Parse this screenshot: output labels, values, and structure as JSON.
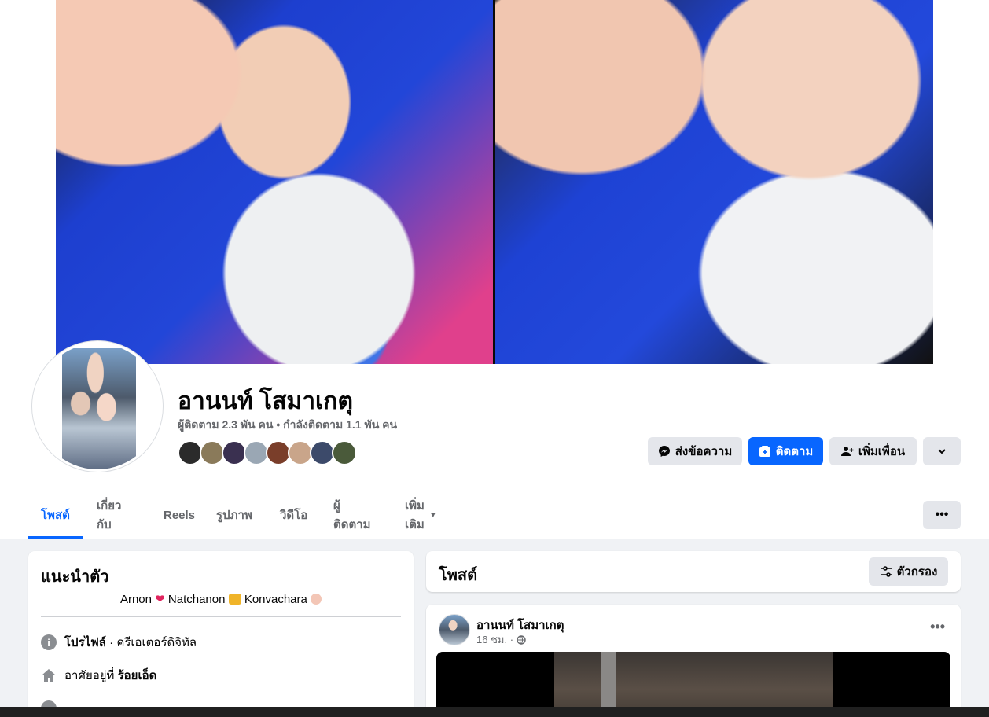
{
  "profile": {
    "name": "อานนท์ โสมาเกตุ",
    "stats": "ผู้ติดตาม 2.3 พัน คน • กำลังติดตาม 1.1 พัน คน"
  },
  "actions": {
    "message": "ส่งข้อความ",
    "follow": "ติดตาม",
    "add_friend": "เพิ่มเพื่อน"
  },
  "tabs": [
    {
      "label": "โพสต์",
      "active": true
    },
    {
      "label": "เกี่ยวกับ",
      "active": false
    },
    {
      "label": "Reels",
      "active": false
    },
    {
      "label": "รูปภาพ",
      "active": false
    },
    {
      "label": "วิดีโอ",
      "active": false
    },
    {
      "label": "ผู้ติดตาม",
      "active": false
    },
    {
      "label": "เพิ่มเติม",
      "active": false
    }
  ],
  "intro": {
    "title": "แนะนำตัว",
    "bio": {
      "part1": "Arnon",
      "part2": "Natchanon",
      "part3": "Konvachara"
    },
    "profile_label": "โปรไฟล์",
    "profile_value": " · ครีเอเตอร์ดิจิทัล",
    "lives_prefix": "อาศัยอยู่ที่ ",
    "lives_value": "ร้อยเอ็ด"
  },
  "posts": {
    "title": "โพสต์",
    "filter_label": "ตัวกรอง"
  },
  "post": {
    "author": "อานนท์ โสมาเกตุ",
    "time": "16 ชม. ·"
  },
  "colors": {
    "accent": "#0866ff",
    "button_grey": "#e4e6eb",
    "page_bg": "#f0f2f5"
  }
}
